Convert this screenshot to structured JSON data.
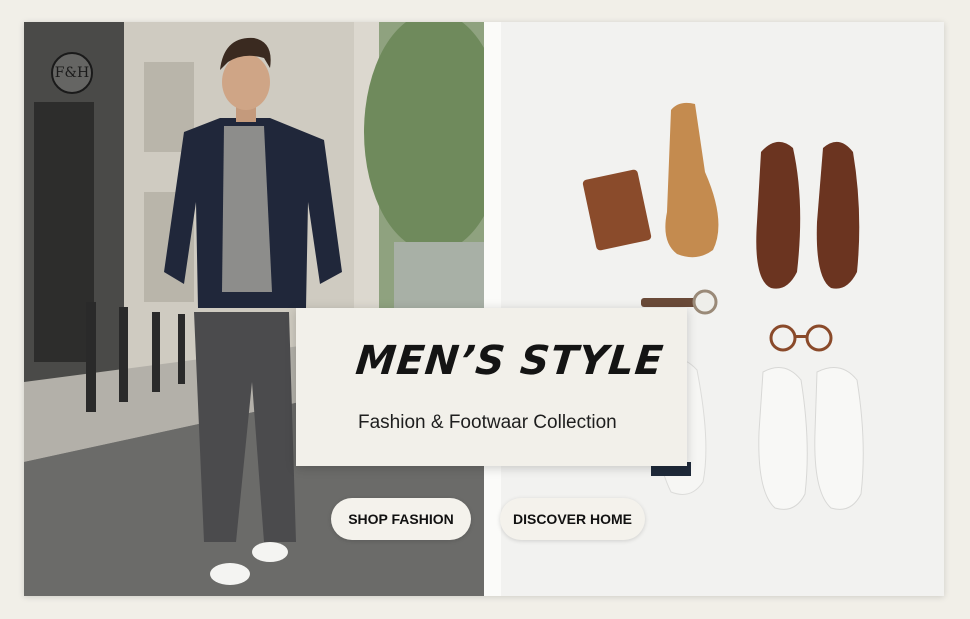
{
  "brand": {
    "logo_text": "F&H"
  },
  "hero": {
    "title": "MEN’S STYLE",
    "subtitle": "Fashion & Footwaar Collection"
  },
  "actions": {
    "shop_fashion": "SHOP FASHION",
    "discover_home": "DISCOVER HOME"
  },
  "colors": {
    "page_background": "#f1efe8",
    "card_background": "#f2f0ea",
    "button_background": "#f4f2ec",
    "text": "#141414"
  },
  "icons": {
    "logo": "fh-monogram-icon"
  }
}
